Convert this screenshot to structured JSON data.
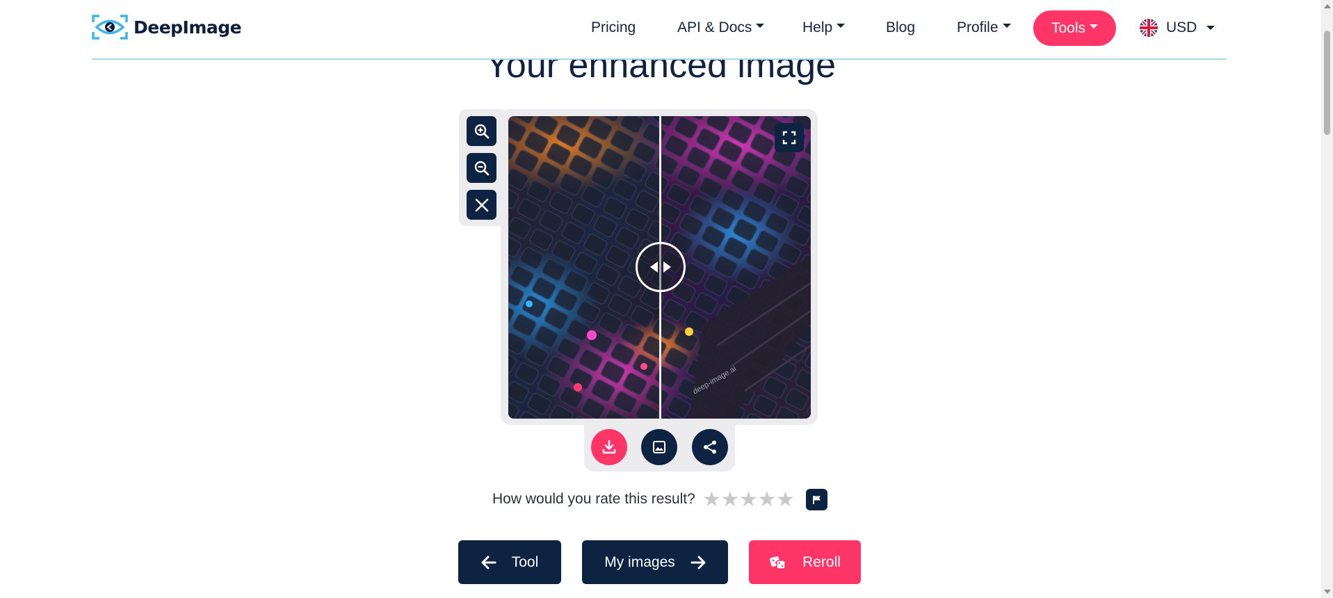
{
  "brand": {
    "name": "DeepImage"
  },
  "nav": {
    "pricing": "Pricing",
    "api_docs": "API & Docs",
    "help": "Help",
    "blog": "Blog",
    "profile": "Profile",
    "tools": "Tools",
    "currency": "USD"
  },
  "page": {
    "heading": "Your enhanced image"
  },
  "viewer": {
    "watermark": "deep-image.ai",
    "tool_icons": [
      "zoom-in-icon",
      "zoom-out-icon",
      "close-icon"
    ],
    "action_icons": [
      "download-icon",
      "image-icon",
      "share-icon"
    ]
  },
  "rating": {
    "question": "How would you rate this result?",
    "max_stars": 5,
    "current": 0
  },
  "buttons": {
    "tool": "Tool",
    "my_images": "My images",
    "reroll": "Reroll"
  },
  "colors": {
    "primary": "#0e2242",
    "accent": "#ff3568",
    "nav_line": "#a9dcea",
    "logo": "#3fb6e6"
  }
}
